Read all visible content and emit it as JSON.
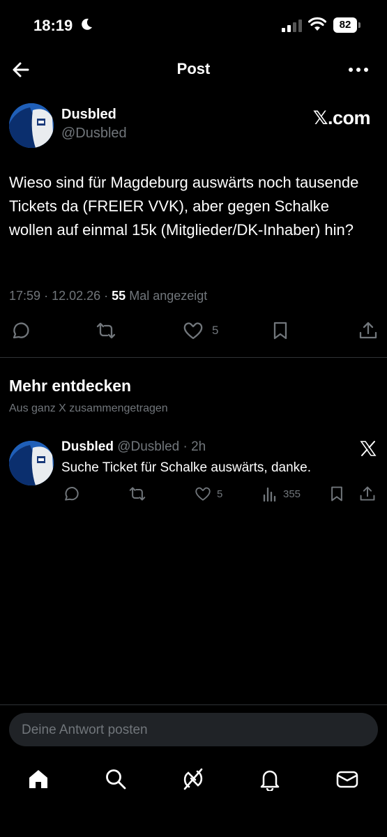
{
  "status_bar": {
    "time": "18:19",
    "battery": "82"
  },
  "header": {
    "title": "Post"
  },
  "post": {
    "author_name": "Dusbled",
    "author_handle": "@Dusbled",
    "source_badge": "𝕏.com",
    "text": "Wieso sind für Magdeburg auswärts noch tausende Tickets da (FREIER VVK), aber gegen Schalke wollen auf einmal 15k (Mitglieder/DK-Inhaber) hin?",
    "time": "17:59",
    "date": "12.02.26",
    "views": "55",
    "views_label": "Mal angezeigt",
    "likes": "5"
  },
  "discover": {
    "title": "Mehr entdecken",
    "subtitle": "Aus ganz X zusammengetragen"
  },
  "recommended": {
    "author_name": "Dusbled",
    "author_meta": "@Dusbled · 2h",
    "text": "Suche Ticket für Schalke auswärts, danke.",
    "likes": "5",
    "views": "355"
  },
  "reply": {
    "placeholder": "Deine Antwort posten"
  },
  "tabs": [
    "home-icon",
    "search-icon",
    "grok-icon",
    "notifications-icon",
    "messages-icon"
  ]
}
